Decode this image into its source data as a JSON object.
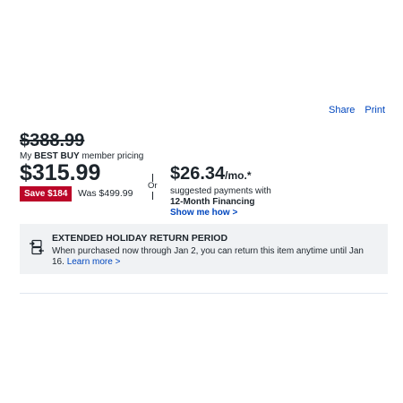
{
  "links": {
    "share": "Share",
    "print": "Print"
  },
  "pricing": {
    "original_price": "$388.99",
    "member_prefix": "My ",
    "member_brand": "BEST BUY",
    "member_suffix": " member pricing",
    "current_price": "$315.99",
    "save_badge": "Save $184",
    "was_price": "Was $499.99",
    "or_label": "Or"
  },
  "financing": {
    "monthly_amount": "$26.34",
    "monthly_suffix": "/mo.*",
    "suggested": "suggested payments with",
    "plan": "12-Month Financing",
    "show_link": "Show me how >"
  },
  "holiday": {
    "icon": "exchange-arrows-icon",
    "title": "EXTENDED HOLIDAY RETURN PERIOD",
    "text": "When purchased now through Jan 2, you can return this item anytime until Jan 16.",
    "learn_more": "Learn more >"
  },
  "colors": {
    "link": "#0046be",
    "save_badge": "#bb0628",
    "panel": "#f0f2f4"
  }
}
